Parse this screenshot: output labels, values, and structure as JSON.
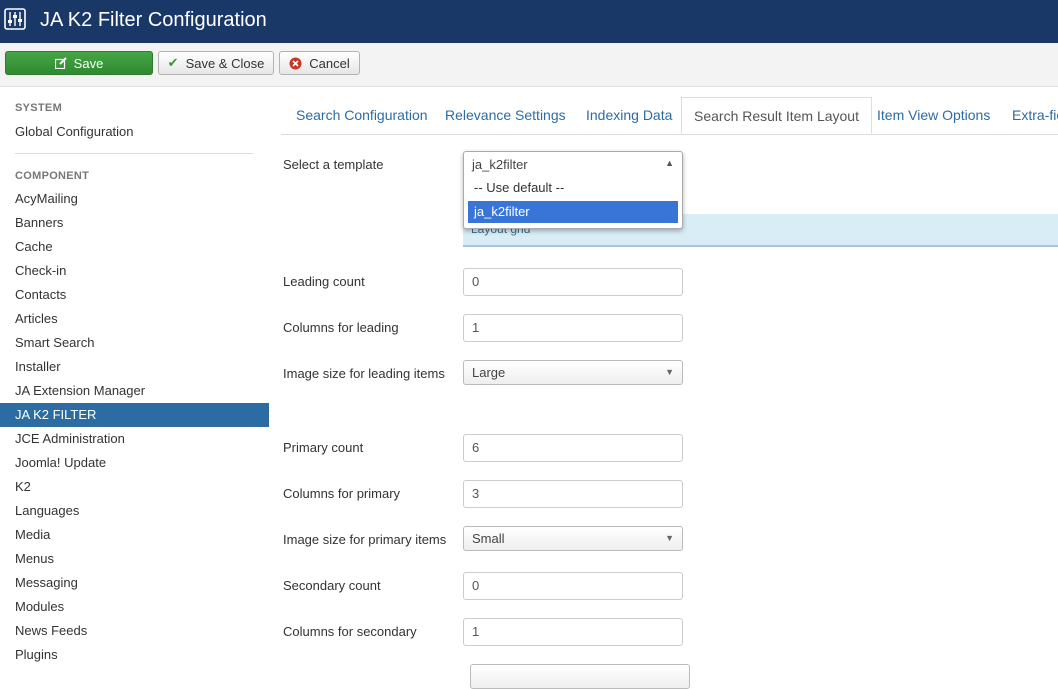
{
  "header": {
    "title": "JA K2 Filter Configuration",
    "logo_icon": "equalizer-icon"
  },
  "toolbar": {
    "save_label": "Save",
    "save_close_label": "Save & Close",
    "cancel_label": "Cancel"
  },
  "sidebar": {
    "system_heading": "SYSTEM",
    "global_config": "Global Configuration",
    "component_heading": "COMPONENT",
    "items": [
      "AcyMailing",
      "Banners",
      "Cache",
      "Check-in",
      "Contacts",
      "Articles",
      "Smart Search",
      "Installer",
      "JA Extension Manager",
      "JA K2 FILTER",
      "JCE Administration",
      "Joomla! Update",
      "K2",
      "Languages",
      "Media",
      "Menus",
      "Messaging",
      "Modules",
      "News Feeds",
      "Plugins"
    ],
    "active_index": 9
  },
  "tabs": [
    "Search Configuration",
    "Relevance Settings",
    "Indexing Data",
    "Search Result Item Layout",
    "Item View Options",
    "Extra-fie"
  ],
  "active_tab": 3,
  "form": {
    "select_template_label": "Select a template",
    "template_value": "ja_k2filter",
    "template_options": [
      "-- Use default --",
      "ja_k2filter"
    ],
    "layout_grid_label": "Layout grid",
    "leading_count_label": "Leading count",
    "leading_count_value": "0",
    "columns_leading_label": "Columns for leading",
    "columns_leading_value": "1",
    "image_size_leading_label": "Image size for leading items",
    "image_size_leading_value": "Large",
    "primary_count_label": "Primary count",
    "primary_count_value": "6",
    "columns_primary_label": "Columns for primary",
    "columns_primary_value": "3",
    "image_size_primary_label": "Image size for primary items",
    "image_size_primary_value": "Small",
    "secondary_count_label": "Secondary count",
    "secondary_count_value": "0",
    "columns_secondary_label": "Columns for secondary",
    "columns_secondary_value": "1"
  },
  "colors": {
    "header_bg": "#1a3867",
    "save_green": "#3b963b",
    "active_blue": "#2d6ca2",
    "dropdown_highlight": "#3875d7"
  }
}
